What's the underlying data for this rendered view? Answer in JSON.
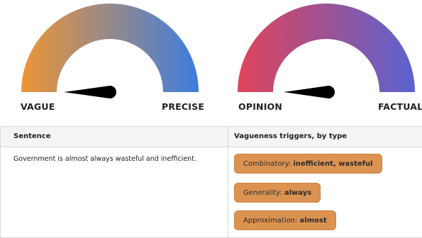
{
  "gauges": [
    {
      "left_label": "VAGUE",
      "right_label": "PRECISE",
      "color_start": "#ee9535",
      "color_end": "#3d7de0",
      "needle_color": "#000000"
    },
    {
      "left_label": "OPINION",
      "right_label": "FACTUAL",
      "color_start": "#e0445a",
      "color_end": "#5a62d0",
      "needle_color": "#000000"
    }
  ],
  "table": {
    "headers": [
      "Sentence",
      "Vagueness triggers, by type"
    ],
    "sentence": "Government is almost always wasteful and inefficient.",
    "triggers": [
      {
        "type": "Combinatory:",
        "words": "inefficient, wasteful"
      },
      {
        "type": "Generality:",
        "words": "always"
      },
      {
        "type": "Approximation:",
        "words": "almost"
      }
    ],
    "chip_color": "#dc9351"
  }
}
